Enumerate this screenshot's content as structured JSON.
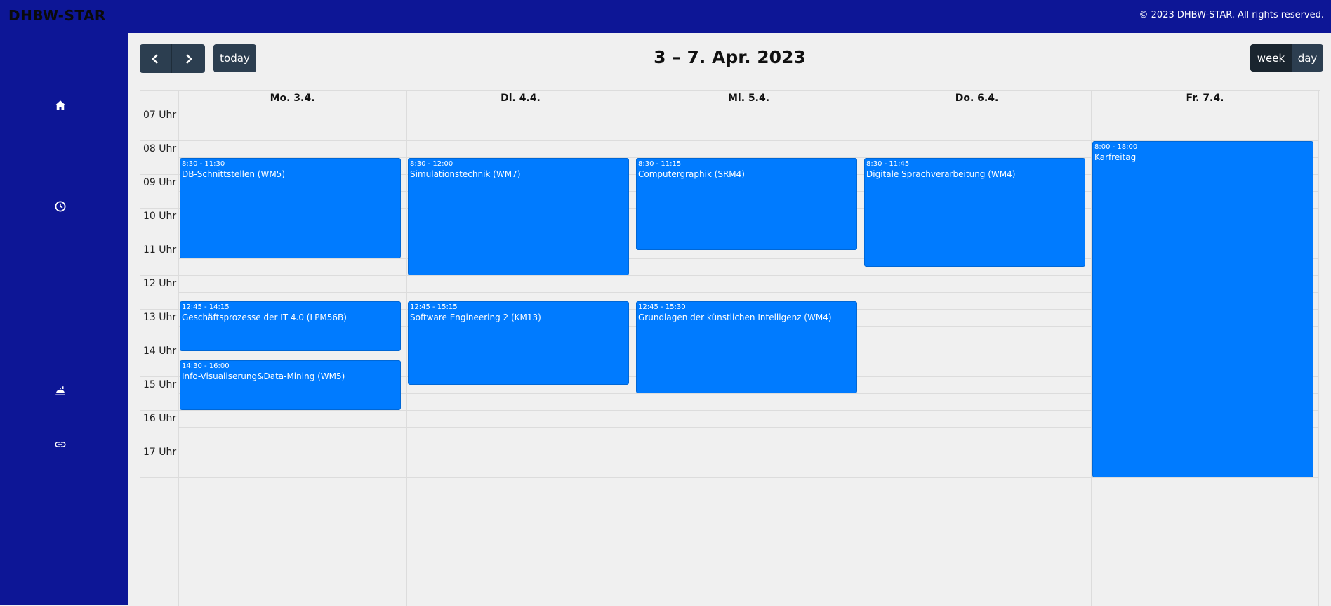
{
  "app": {
    "brand": "DHBW-STAR",
    "copyright": "© 2023 DHBW-STAR. All rights reserved."
  },
  "sidebar": [
    {
      "icon": "home-icon"
    },
    {
      "icon": "clock-icon"
    },
    {
      "icon": "food-icon"
    },
    {
      "icon": "link-icon"
    }
  ],
  "toolbar": {
    "prev_icon": "chevron-left-icon",
    "next_icon": "chevron-right-icon",
    "today_label": "today",
    "title": "3 – 7. Apr. 2023",
    "week_label": "week",
    "day_label": "day",
    "active_view": "week"
  },
  "calendar": {
    "days": [
      "Mo. 3.4.",
      "Di. 4.4.",
      "Mi. 5.4.",
      "Do. 6.4.",
      "Fr. 7.4."
    ],
    "hours": [
      "07 Uhr",
      "08 Uhr",
      "09 Uhr",
      "10 Uhr",
      "11 Uhr",
      "12 Uhr",
      "13 Uhr",
      "14 Uhr",
      "15 Uhr",
      "16 Uhr",
      "17 Uhr"
    ],
    "events": [
      {
        "day": 0,
        "start": 8.5,
        "end": 11.5,
        "time": "8:30 - 11:30",
        "title": "DB-Schnittstellen (WM5)"
      },
      {
        "day": 0,
        "start": 12.75,
        "end": 14.25,
        "time": "12:45 - 14:15",
        "title": "Geschäftsprozesse der IT 4.0 (LPM56B)"
      },
      {
        "day": 0,
        "start": 14.5,
        "end": 16.0,
        "time": "14:30 - 16:00",
        "title": "Info-Visualiserung&Data-Mining (WM5)"
      },
      {
        "day": 1,
        "start": 8.5,
        "end": 12.0,
        "time": "8:30 - 12:00",
        "title": "Simulationstechnik (WM7)"
      },
      {
        "day": 1,
        "start": 12.75,
        "end": 15.25,
        "time": "12:45 - 15:15",
        "title": "Software Engineering 2 (KM13)"
      },
      {
        "day": 2,
        "start": 8.5,
        "end": 11.25,
        "time": "8:30 - 11:15",
        "title": "Computergraphik (SRM4)"
      },
      {
        "day": 2,
        "start": 12.75,
        "end": 15.5,
        "time": "12:45 - 15:30",
        "title": "Grundlagen der künstlichen Intelligenz (WM4)"
      },
      {
        "day": 3,
        "start": 8.5,
        "end": 11.75,
        "time": "8:30 - 11:45",
        "title": "Digitale Sprachverarbeitung (WM4)"
      },
      {
        "day": 4,
        "start": 8.0,
        "end": 18.0,
        "time": "8:00 - 18:00",
        "title": "Karfreitag"
      }
    ]
  },
  "colors": {
    "topbar": "#0d1696",
    "event": "#007bff",
    "toolbar_button": "#2c3e50",
    "active_view": "#1a252f"
  }
}
